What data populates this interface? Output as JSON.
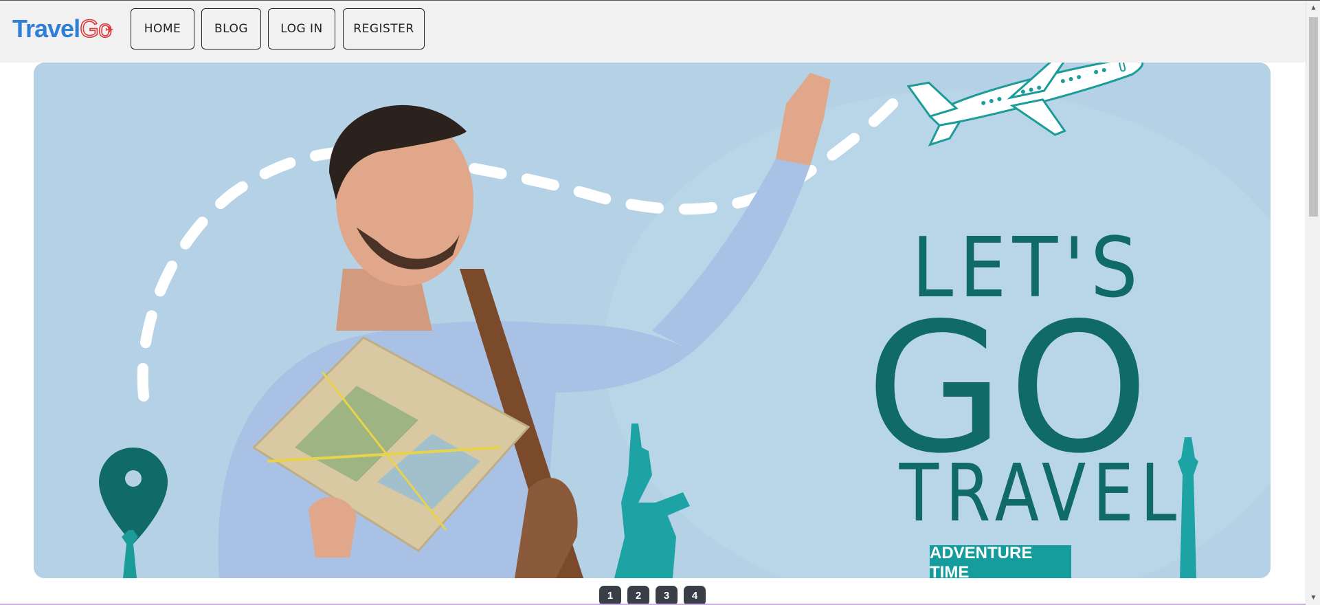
{
  "logo": {
    "part1": "Travel",
    "part2": "Go",
    "plane_icon": "plane-icon"
  },
  "nav": {
    "home": "HOME",
    "blog": "BLOG",
    "login": "LOG IN",
    "register": "REGISTER"
  },
  "hero": {
    "line1": "LET'S",
    "line2": "GO",
    "line3": "TRAVEL",
    "badge": "ADVENTURE TIME"
  },
  "pager": [
    "1",
    "2",
    "3",
    "4"
  ],
  "colors": {
    "brand_blue": "#2f7fd7",
    "brand_red": "#e0383c",
    "hero_text": "#0f6a68",
    "teal": "#159d9d",
    "hero_bg": "#b3d0e4",
    "pager_bg": "#3a3f47"
  }
}
